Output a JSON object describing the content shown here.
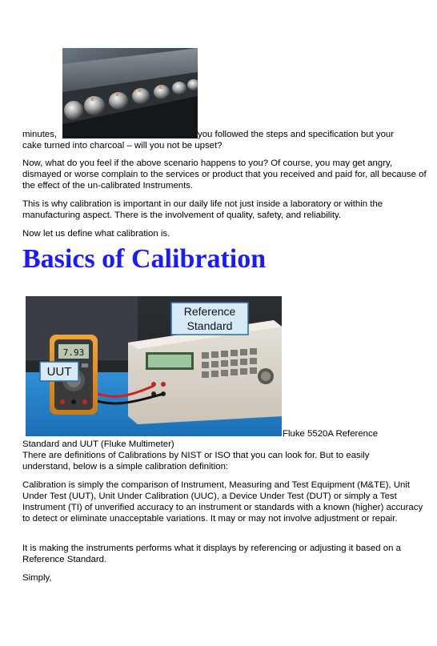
{
  "intro": {
    "line1_start": "minutes,",
    "line1_end": "you followed the steps and specification but your",
    "line2": "cake turned into charcoal – will you not be upset?"
  },
  "paragraphs": {
    "p_scenario": "Now, what do you feel if the above scenario happens to you? Of course, you may get angry, dismayed or worse complain to the services or product that you received and paid for, all because of the effect of the un-calibrated Instruments.",
    "p_why": "This is why calibration is important in our daily life not just inside a laboratory or within the manufacturing aspect. There is the involvement of quality, safety, and reliability.",
    "p_define": "Now let us define what calibration is."
  },
  "section": {
    "heading": "Basics of Calibration"
  },
  "figure": {
    "caption_start": "Fluke 5520A Reference",
    "caption_end": "Standard and UUT (Fluke Multimeter)",
    "label_reference": "Reference Standard",
    "label_reference_line1": "Reference",
    "label_reference_line2": "Standard",
    "label_uut": "UUT",
    "meter_reading": "7.93"
  },
  "body": {
    "p_definitions": "There are definitions of Calibrations by NIST or ISO that you can look for. But to easily understand, below is a simple calibration definition:",
    "p_definition": "Calibration is simply the comparison of Instrument, Measuring and Test Equipment (M&TE), Unit Under Test (UUT), Unit Under Calibration (UUC), a Device Under Test (DUT) or simply a Test Instrument  (TI) of unverified accuracy  to an instrument or standards with a known (higher) accuracy to detect or eliminate unacceptable variations. It may or may not involve adjustment or repair.",
    "p_making": "It is making the instruments performs what it displays by referencing or adjusting it based on a Reference Standard.",
    "p_simply": "Simply,"
  },
  "colors": {
    "heading": "#1a1aff",
    "text": "#000000",
    "label_box": "#d6eaf8",
    "label_border": "#2b6ea8"
  }
}
